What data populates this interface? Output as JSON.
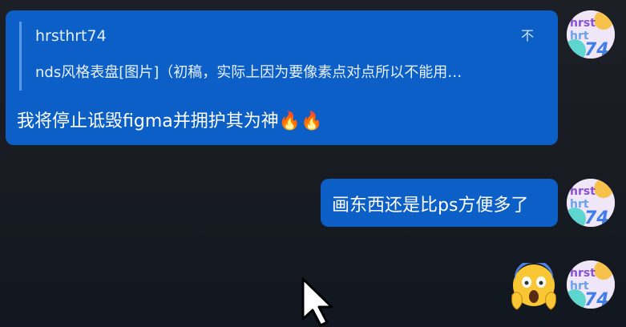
{
  "messages": [
    {
      "quote": {
        "author": "hrsthrt74",
        "text": "nds风格表盘[图片]（初稿，实际上因为要像素点对点所以不能用…",
        "jump_icon": "不"
      },
      "text": "我将停止诋毁figma并拥护其为神🔥🔥"
    },
    {
      "text": "画东西还是比ps方便多了"
    },
    {
      "emoji": "screaming-face-emoji"
    }
  ],
  "avatar": {
    "lines": [
      "hrst",
      "hrt",
      "74"
    ]
  },
  "colors": {
    "bubble": "#0b5fc6",
    "quote_bar": "#5b97e6",
    "background": "#1a1d24"
  }
}
